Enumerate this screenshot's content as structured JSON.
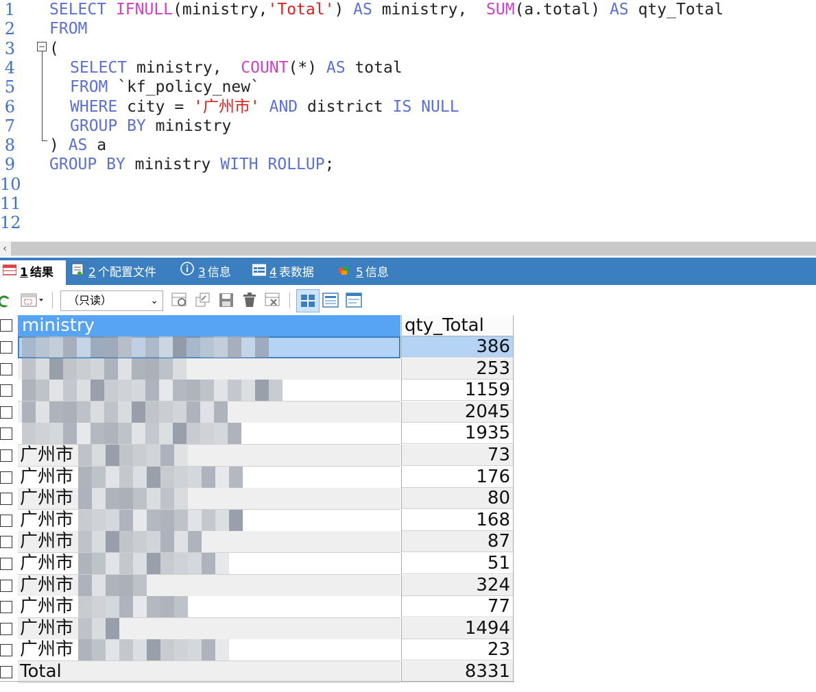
{
  "editor": {
    "lines": [
      {
        "n": "1",
        "tokens": [
          [
            "kw",
            "SELECT "
          ],
          [
            "fn",
            "IFNULL"
          ],
          [
            "",
            "(ministry,"
          ],
          [
            "str",
            "'Total'"
          ],
          [
            "",
            ") "
          ],
          [
            "kw",
            "AS"
          ],
          [
            "",
            " ministry,  "
          ],
          [
            "fn",
            "SUM"
          ],
          [
            "",
            "(a.total) "
          ],
          [
            "kw",
            "AS"
          ],
          [
            "",
            " qty_Total"
          ]
        ]
      },
      {
        "n": "2",
        "tokens": [
          [
            "kw",
            "FROM"
          ]
        ]
      },
      {
        "n": "3",
        "tokens": [
          [
            "",
            "("
          ]
        ]
      },
      {
        "n": "4",
        "tokens": [
          [
            "kw",
            "SELECT"
          ],
          [
            "",
            " ministry,  "
          ],
          [
            "fn",
            "COUNT"
          ],
          [
            "",
            "(*) "
          ],
          [
            "kw",
            "AS"
          ],
          [
            "",
            " total"
          ]
        ]
      },
      {
        "n": "5",
        "tokens": [
          [
            "kw",
            "FROM"
          ],
          [
            "",
            " `kf_policy_new`"
          ]
        ]
      },
      {
        "n": "6",
        "tokens": [
          [
            "kw",
            "WHERE"
          ],
          [
            "",
            " city = "
          ],
          [
            "str",
            "'广州市'"
          ],
          [
            "",
            " "
          ],
          [
            "kw",
            "AND"
          ],
          [
            "",
            " district "
          ],
          [
            "kw",
            "IS NULL"
          ]
        ]
      },
      {
        "n": "7",
        "tokens": [
          [
            "kw",
            "GROUP BY"
          ],
          [
            "",
            " ministry"
          ]
        ]
      },
      {
        "n": "8",
        "tokens": [
          [
            "",
            ") "
          ],
          [
            "kw",
            "AS"
          ],
          [
            "",
            " a"
          ]
        ]
      },
      {
        "n": "9",
        "tokens": [
          [
            "kw",
            "GROUP BY"
          ],
          [
            "",
            " ministry "
          ],
          [
            "kw",
            "WITH ROLLUP"
          ],
          [
            "",
            ";"
          ]
        ]
      },
      {
        "n": "10",
        "tokens": []
      },
      {
        "n": "11",
        "tokens": []
      },
      {
        "n": "12",
        "tokens": []
      }
    ],
    "fold_symbol": "−",
    "scroll_left_arrow": "‹"
  },
  "tabs": [
    {
      "num": "1",
      "label": "结果",
      "icon": "result-grid-icon"
    },
    {
      "num": "2",
      "label": "个配置文件",
      "icon": "profile-icon"
    },
    {
      "num": "3",
      "label": "信息",
      "icon": "info-icon"
    },
    {
      "num": "4",
      "label": "表数据",
      "icon": "table-data-icon"
    },
    {
      "num": "5",
      "label": "信息",
      "icon": "info-color-icon"
    }
  ],
  "toolbar": {
    "readonly_label": "（只读）",
    "readonly_caret": "⌄"
  },
  "grid": {
    "headers": {
      "ministry": "ministry",
      "qty": "qty_Total"
    },
    "rows": [
      {
        "ministry": "",
        "qty": "386"
      },
      {
        "ministry": "",
        "qty": "253"
      },
      {
        "ministry": "",
        "qty": "1159"
      },
      {
        "ministry": "",
        "qty": "2045"
      },
      {
        "ministry": "",
        "qty": "1935"
      },
      {
        "ministry": "广州市",
        "qty": "73"
      },
      {
        "ministry": "广州市",
        "qty": "176"
      },
      {
        "ministry": "广州市",
        "qty": "80"
      },
      {
        "ministry": "广州市",
        "qty": "168"
      },
      {
        "ministry": "广州市",
        "qty": "87"
      },
      {
        "ministry": "广州市",
        "qty": "51"
      },
      {
        "ministry": "广州市",
        "qty": "324"
      },
      {
        "ministry": "广州市",
        "qty": "77"
      },
      {
        "ministry": "广州市",
        "qty": "1494"
      },
      {
        "ministry": "广州市",
        "qty": "23"
      },
      {
        "ministry": "Total",
        "qty": "8331"
      }
    ]
  },
  "colors": {
    "keyword": "#5a6fd8",
    "function": "#d33fc6",
    "string": "#e0201a",
    "tabbar": "#3c7fc0",
    "header_selected": "#58a4f4",
    "row_selected": "#b5d3f5"
  }
}
